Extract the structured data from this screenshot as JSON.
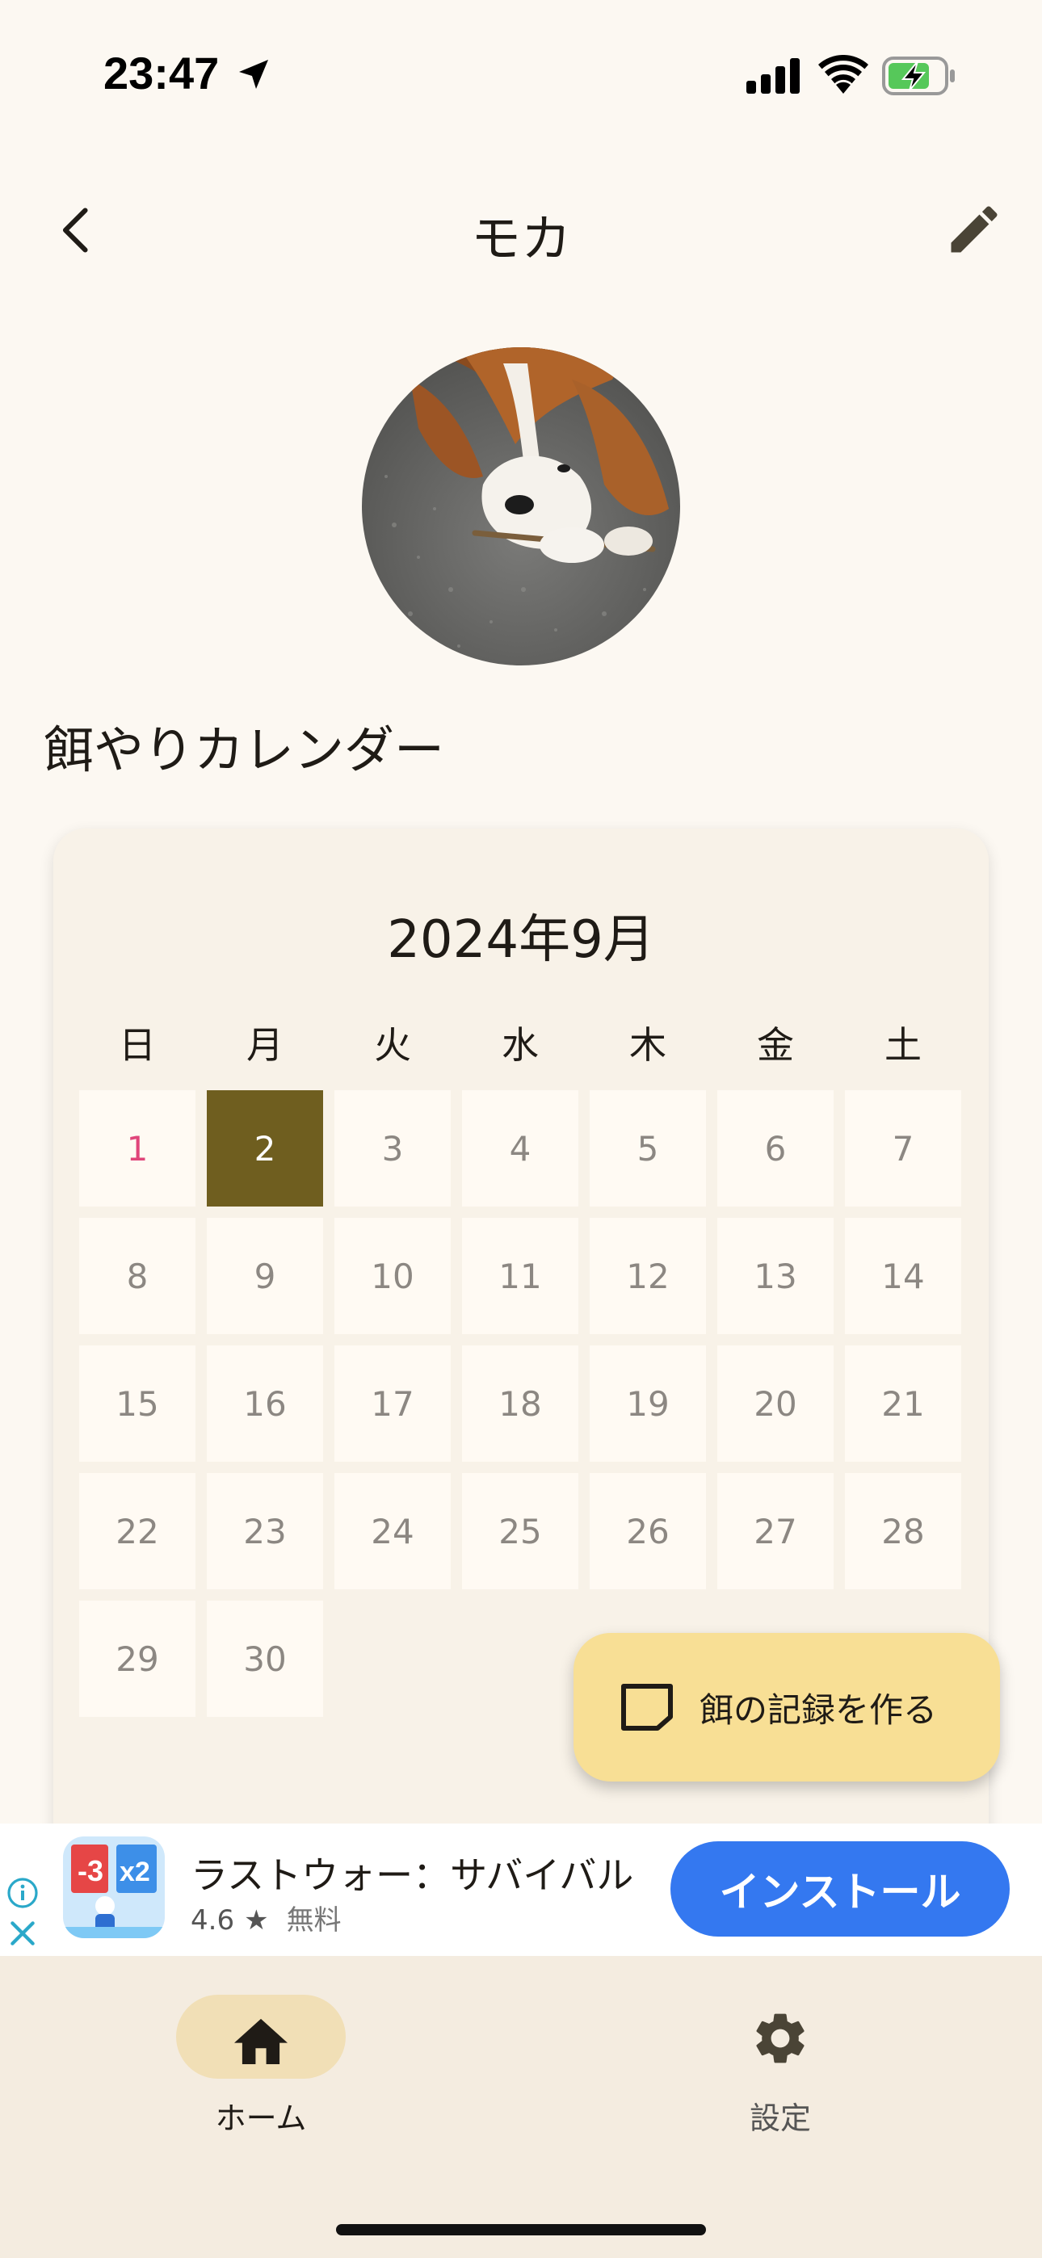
{
  "status_bar": {
    "time": "23:47"
  },
  "header": {
    "title": "モカ"
  },
  "section": {
    "title": "餌やりカレンダー"
  },
  "calendar": {
    "month_label": "2024年9月",
    "weekdays": [
      "日",
      "月",
      "火",
      "水",
      "木",
      "金",
      "土"
    ],
    "days": [
      "1",
      "2",
      "3",
      "4",
      "5",
      "6",
      "7",
      "8",
      "9",
      "10",
      "11",
      "12",
      "13",
      "14",
      "15",
      "16",
      "17",
      "18",
      "19",
      "20",
      "21",
      "22",
      "23",
      "24",
      "25",
      "26",
      "27",
      "28",
      "29",
      "30"
    ],
    "selected_day": "2"
  },
  "fab": {
    "label": "餌の記録を作る",
    "icon": "note-icon"
  },
  "ad": {
    "title": "ラストウォー：サバイバル",
    "rating": "4.6",
    "price": "無料",
    "install_label": "インストール"
  },
  "bottom_nav": {
    "items": [
      {
        "label": "ホーム",
        "icon": "home-icon",
        "active": true
      },
      {
        "label": "設定",
        "icon": "gear-icon",
        "active": false
      }
    ]
  },
  "colors": {
    "background": "#fcf8f2",
    "selected_day": "#6f5e1f",
    "fab": "#f8df95",
    "install_button": "#3478f0",
    "nav_active_pill": "#f1dfb6"
  }
}
